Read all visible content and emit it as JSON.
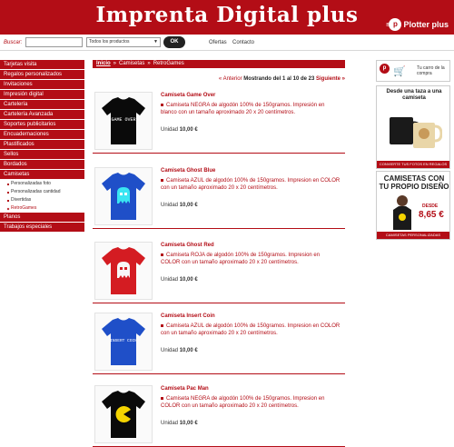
{
  "header": {
    "logo_text": "Imprenta Digital plus",
    "by_label": "BY",
    "partner_icon_letter": "p",
    "partner_name": "Plotter plus"
  },
  "search": {
    "label": "Buscar:",
    "input_value": "",
    "category_selected": "Todos los productos",
    "ok_label": "OK",
    "link_offers": "Ofertas",
    "link_contact": "Contacto"
  },
  "sidebar": {
    "categories": [
      "Tarjetas visita",
      "Regalos personalizados",
      "Invitaciones",
      "Impresión digital",
      "Cartelería",
      "Cartelería Avanzada",
      "Soportes publicitarios",
      "Encuadernaciones",
      "Plastificados",
      "Sellos",
      "Bordados",
      "Camisetas"
    ],
    "subcategories": [
      "Personalizadas foto",
      "Personalizadas cantidad",
      "Divertidas",
      "RetroGames"
    ],
    "categories_after": [
      "Planos",
      "Trabajos especiales"
    ]
  },
  "breadcrumb": {
    "home": "Inicio",
    "level1": "Camisetas",
    "level2": "RetroGames",
    "separator": "»"
  },
  "pagination": {
    "prev": "« Anterior",
    "info": "Mostrando del 1 al 10 de 23",
    "next": "Siguiente »"
  },
  "products": [
    {
      "title": "Camiseta Game Over",
      "description": "Camiseta NEGRA de algodón 100% de 150gramos. Impresión en blanco con un tamaño aproximado 20 x 20 centímetros.",
      "price_label": "Unidad",
      "price": "10,00 €",
      "shirt_color": "#0a0a0a",
      "print_text": "GAME OVER"
    },
    {
      "title": "Camiseta Ghost Blue",
      "description": "Camiseta AZUL de algodón 100% de 150gramos. Impresion en COLOR con un tamaño aproximado 20 x 20 centímetros.",
      "price_label": "Unidad",
      "price": "10,00 €",
      "shirt_color": "#1f4fc8",
      "ghost_color": "#39e5f2"
    },
    {
      "title": "Camiseta Ghost Red",
      "description": "Camiseta ROJA de algodón 100% de 150gramos. Impresion en COLOR con un tamaño aproximado 20 x 20 centímetros.",
      "price_label": "Unidad",
      "price": "10,00 €",
      "shirt_color": "#d41c22",
      "ghost_color": "#f7f7f7"
    },
    {
      "title": "Camiseta Insert Coin",
      "description": "Camiseta AZUL de algodón 100% de 150gramos. Impresion en COLOR con un tamaño aproximado 20 x 20 centímetros.",
      "price_label": "Unidad",
      "price": "10,00 €",
      "shirt_color": "#1f4fc8",
      "print_text": "INSERT COIN"
    },
    {
      "title": "Camiseta Pac Man",
      "description": "Camiseta NEGRA de algodón 100% de 150gramos. Impresion en COLOR con un tamaño aproximado 20 x 20 centímetros.",
      "price_label": "Unidad",
      "price": "10,00 €",
      "shirt_color": "#0a0a0a",
      "print_color": "#f4d400"
    }
  ],
  "ads": {
    "cart_icon_letter": "p",
    "cart_text": "Tu carro de la compra",
    "mug_title": "Desde una taza a una camiseta",
    "mug_footer": "CONVIERTE TUS FOTOS EN REGALOS",
    "shirt_title": "CAMISETAS CON TU PROPIO DISEÑO",
    "shirt_desde": "DESDE",
    "shirt_price": "8,65 €",
    "shirt_footer": "CAMISETAS PERSONALIZADAS"
  },
  "colors": {
    "brand_red": "#b30d16",
    "text_dark": "#333333"
  }
}
